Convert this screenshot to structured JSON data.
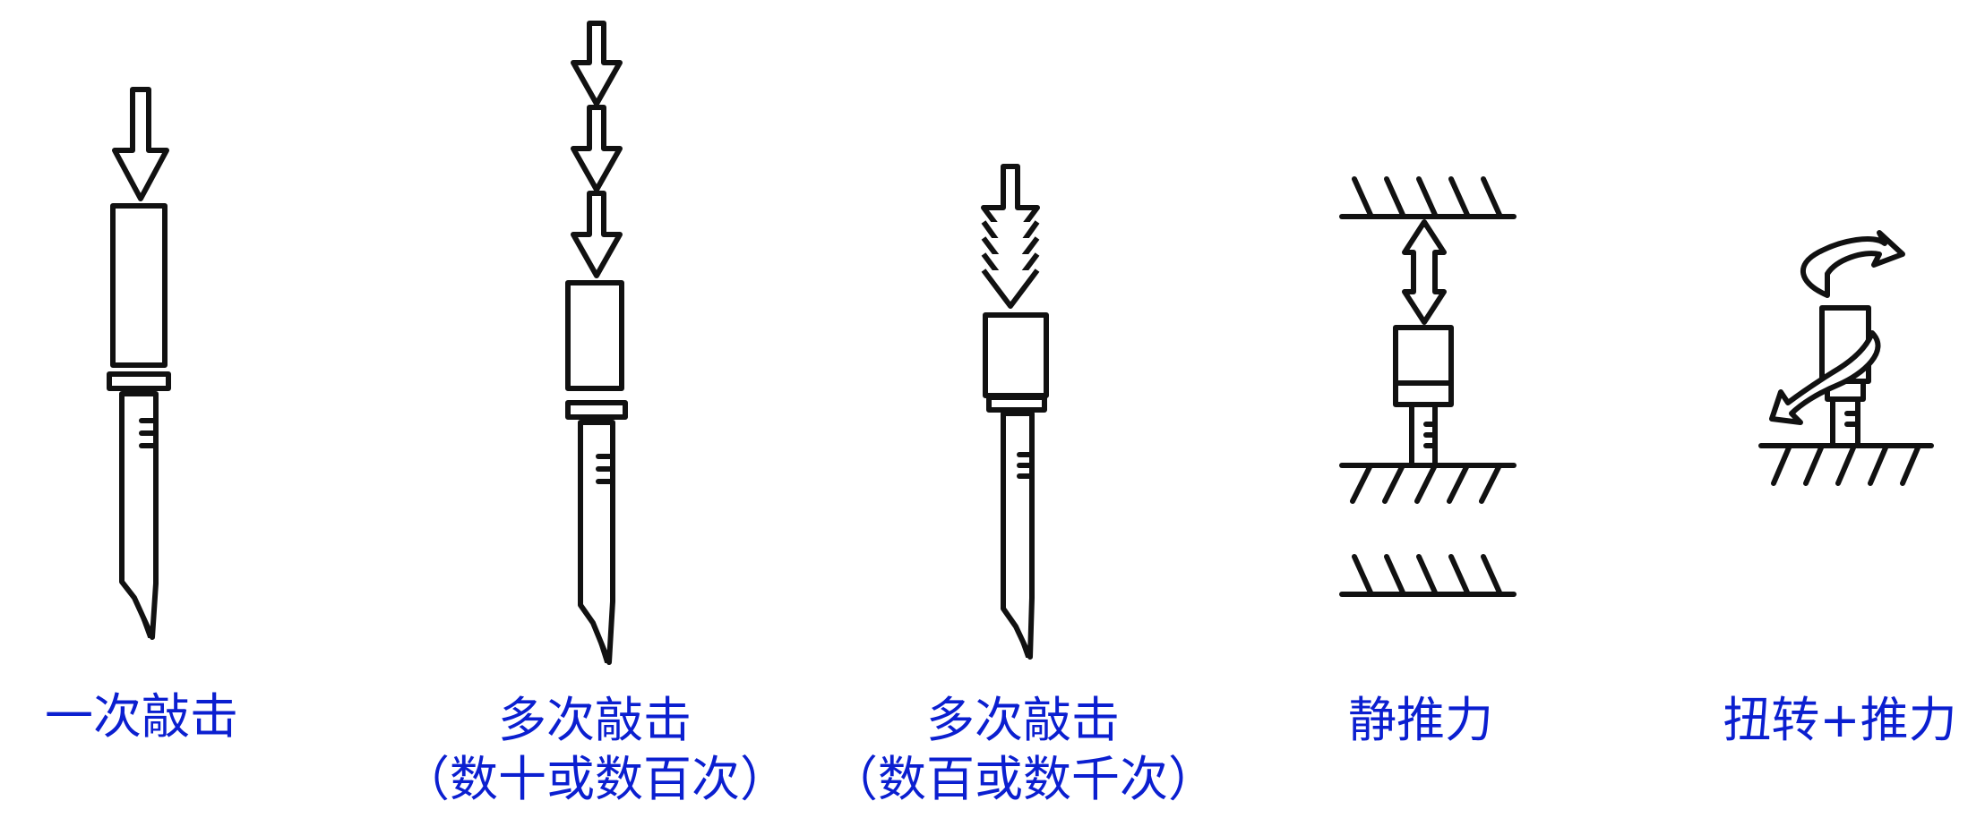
{
  "figures": [
    {
      "id": "single-strike",
      "caption": [
        "一次敲击"
      ]
    },
    {
      "id": "multi-strike-tens",
      "caption": [
        "多次敲击",
        "（数十或数百次）"
      ]
    },
    {
      "id": "multi-strike-hundreds",
      "caption": [
        "多次敲击",
        "（数百或数千次）"
      ]
    },
    {
      "id": "static-push",
      "caption": [
        "静推力"
      ]
    },
    {
      "id": "twist-push",
      "caption": [
        "扭转+推力"
      ]
    }
  ],
  "colors": {
    "caption": "#0b1fd0",
    "line": "#111111"
  }
}
